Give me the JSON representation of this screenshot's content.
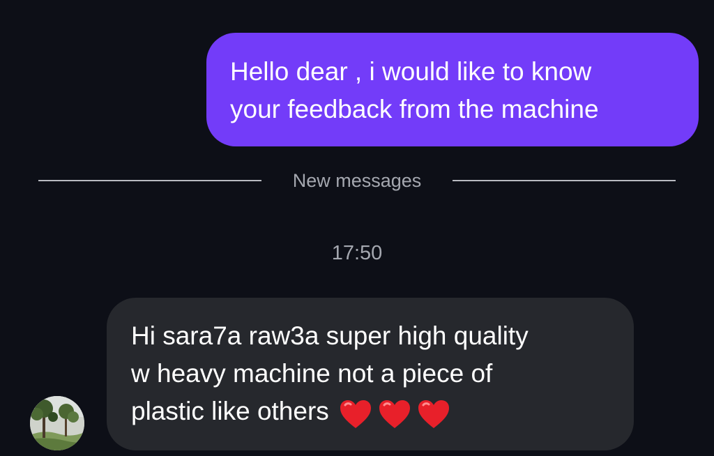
{
  "messages": {
    "outgoing": {
      "lines": [
        "Hello dear , i would like to know",
        "your feedback from the machine"
      ]
    },
    "divider_label": "New messages",
    "timestamp": "17:50",
    "incoming": {
      "lines": [
        "Hi sara7a raw3a super high quality",
        "w heavy machine not a piece of",
        "plastic like others"
      ],
      "emoji": [
        "red-heart",
        "red-heart",
        "red-heart"
      ]
    }
  },
  "colors": {
    "background": "#0d0f17",
    "outgoing_bubble": "#733cf9",
    "incoming_bubble": "#26282d",
    "meta_text": "#a5a8b0"
  }
}
